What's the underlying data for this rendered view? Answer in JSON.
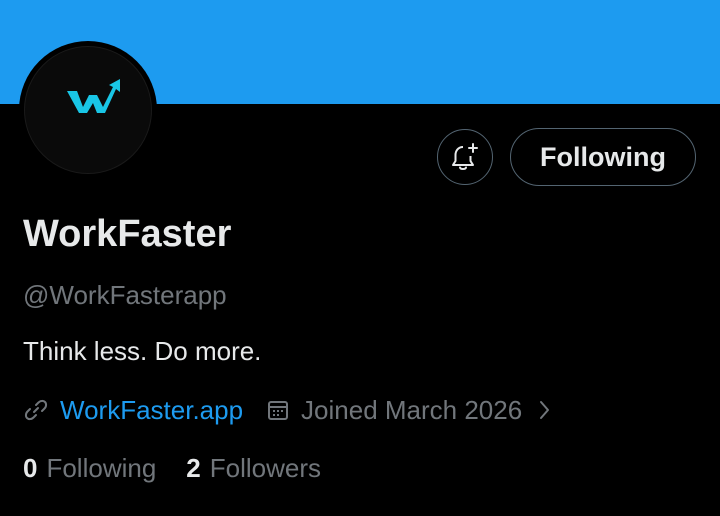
{
  "banner": {
    "color": "#1d9bf0"
  },
  "avatar": {
    "logo_icon": "workfaster-logo-icon",
    "logo_color": "#19c6e6"
  },
  "actions": {
    "notify_icon": "bell-plus-icon",
    "follow_label": "Following"
  },
  "profile": {
    "name": "WorkFaster",
    "handle": "@WorkFasterapp",
    "bio": "Think less. Do more.",
    "website": "WorkFaster.app",
    "joined": "Joined March 2026",
    "link_icon": "link-icon",
    "calendar_icon": "calendar-icon",
    "chevron_icon": "chevron-right-icon"
  },
  "stats": {
    "following_count": "0",
    "following_label": "Following",
    "followers_count": "2",
    "followers_label": "Followers"
  },
  "colors": {
    "background": "#000000",
    "text_primary": "#e7e9ea",
    "text_secondary": "#71767b",
    "accent": "#1d9bf0",
    "border": "#536471"
  }
}
